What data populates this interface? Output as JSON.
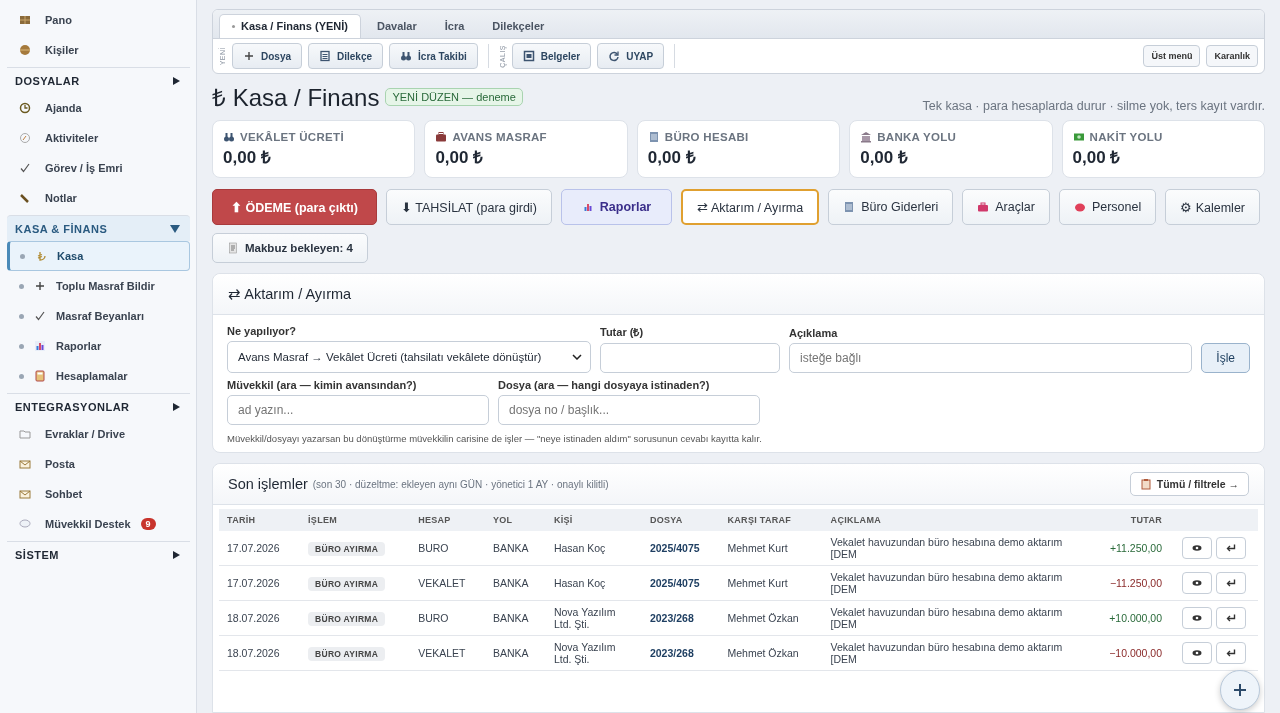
{
  "sidebar": {
    "entries": [
      {
        "kind": "item",
        "label": "Pano",
        "selected": false
      },
      {
        "kind": "item",
        "label": "Kişiler",
        "selected": false
      },
      {
        "kind": "section",
        "label": "DOSYALAR",
        "expanded": false
      },
      {
        "kind": "item",
        "label": "Ajanda",
        "selected": false
      },
      {
        "kind": "item",
        "label": "Aktiviteler",
        "selected": false
      },
      {
        "kind": "item",
        "label": "Görev / İş Emri",
        "selected": false
      },
      {
        "kind": "item",
        "label": "Notlar",
        "selected": false
      },
      {
        "kind": "section",
        "label": "KASA & FİNANS",
        "expanded": true
      },
      {
        "kind": "subitem",
        "label": "Kasa",
        "selected": true
      },
      {
        "kind": "subitem",
        "label": "Toplu Masraf Bildir",
        "selected": false
      },
      {
        "kind": "subitem",
        "label": "Masraf Beyanları",
        "selected": false
      },
      {
        "kind": "subitem",
        "label": "Raporlar",
        "selected": false
      },
      {
        "kind": "subitem",
        "label": "Hesaplamalar",
        "selected": false
      },
      {
        "kind": "section",
        "label": "ENTEGRASYONLAR",
        "expanded": false
      },
      {
        "kind": "item",
        "label": "Evraklar / Drive",
        "selected": false
      },
      {
        "kind": "item",
        "label": "Posta",
        "selected": false
      },
      {
        "kind": "item",
        "label": "Sohbet",
        "selected": false
      },
      {
        "kind": "item",
        "label": "Müvekkil Destek",
        "selected": false,
        "badge": "9"
      },
      {
        "kind": "section",
        "label": "SİSTEM",
        "expanded": false
      }
    ]
  },
  "tabs": [
    {
      "label": "Kasa / Finans (YENİ)",
      "selected": true
    },
    {
      "label": "Davalar",
      "selected": false
    },
    {
      "label": "İcra",
      "selected": false
    },
    {
      "label": "Dilekçeler",
      "selected": false
    }
  ],
  "toolbar": {
    "groups": [
      {
        "label": "YENİ",
        "buttons": [
          "Dosya",
          "Dilekçe",
          "İcra Takibi"
        ]
      },
      {
        "label": "ÇALIŞ",
        "buttons": [
          "Belgeler",
          "UYAP"
        ]
      }
    ],
    "right_buttons": [
      "Üst menü",
      "Karanlık"
    ]
  },
  "page": {
    "title": "₺ Kasa / Finans",
    "badge": "YENİ DÜZEN — deneme",
    "subtitle": "Tek kasa · para hesaplarda durur · silme yok, ters kayıt vardır."
  },
  "stats": [
    {
      "label": "VEKÂLET ÜCRETİ",
      "value": "0,00 ₺"
    },
    {
      "label": "AVANS MASRAF",
      "value": "0,00 ₺"
    },
    {
      "label": "BÜRO HESABI",
      "value": "0,00 ₺"
    },
    {
      "label": "BANKA YOLU",
      "value": "0,00 ₺"
    },
    {
      "label": "NAKİT YOLU",
      "value": "0,00 ₺"
    }
  ],
  "actions": [
    {
      "kind": "danger",
      "label": "⬆ ÖDEME (para çıktı)"
    },
    {
      "kind": "plain",
      "label": "⬇ TAHSİLAT (para girdi)"
    },
    {
      "kind": "primary",
      "label": "Raporlar"
    },
    {
      "kind": "active",
      "label": "⇄ Aktarım / Ayırma"
    },
    {
      "kind": "plain",
      "label": "Büro Giderleri"
    },
    {
      "kind": "plain",
      "label": "Araçlar"
    },
    {
      "kind": "plain",
      "label": "Personel"
    },
    {
      "kind": "plain",
      "label": "⚙ Kalemler"
    },
    {
      "kind": "plain",
      "label": "Makbuz bekleyen: 4"
    }
  ],
  "transfer_form": {
    "title": "⇄ Aktarım / Ayırma",
    "operation": {
      "label": "Ne yapılıyor?",
      "value": "Avans Masraf → Vekâlet Ücreti (tahsilatı vekâlete dönüştür)"
    },
    "amount": {
      "label": "Tutar (₺)"
    },
    "description": {
      "label": "Açıklama",
      "placeholder": "isteğe bağlı"
    },
    "submit": "İşle",
    "client": {
      "label": "Müvekkil (ara — kimin avansından?)",
      "placeholder": "ad yazın..."
    },
    "file": {
      "label": "Dosya (ara — hangi dosyaya istinaden?)",
      "placeholder": "dosya no / başlık..."
    },
    "note": "Müvekkil/dosyayı yazarsan bu dönüştürme müvekkilin carisine de işler — \"neye istinaden aldım\" sorusunun cevabı kayıtta kalır."
  },
  "transactions": {
    "title": "Son işlemler",
    "subtitle": "(son 30 · düzeltme: ekleyen aynı GÜN · yönetici 1 AY · onaylı kilitli)",
    "filter_button": "Tümü / filtrele →",
    "columns": [
      "TARİH",
      "İŞLEM",
      "HESAP",
      "YOL",
      "KİŞİ",
      "DOSYA",
      "KARŞI TARAF",
      "AÇIKLAMA",
      "TUTAR"
    ],
    "rows": [
      {
        "date": "17.07.2026",
        "operation": "BÜRO AYIRMA",
        "account": "BURO",
        "route": "BANKA",
        "person": "Hasan Koç",
        "file": "2025/4075",
        "counterparty": "Mehmet Kurt",
        "description": "Vekalet havuzundan büro hesabına demo aktarım [DEM",
        "amount": "+11.250,00",
        "positive": true
      },
      {
        "date": "17.07.2026",
        "operation": "BÜRO AYIRMA",
        "account": "VEKALET",
        "route": "BANKA",
        "person": "Hasan Koç",
        "file": "2025/4075",
        "counterparty": "Mehmet Kurt",
        "description": "Vekalet havuzundan büro hesabına demo aktarım [DEM",
        "amount": "−11.250,00",
        "positive": false
      },
      {
        "date": "18.07.2026",
        "operation": "BÜRO AYIRMA",
        "account": "BURO",
        "route": "BANKA",
        "person": "Nova Yazılım Ltd. Şti.",
        "file": "2023/268",
        "counterparty": "Mehmet Özkan",
        "description": "Vekalet havuzundan büro hesabına demo aktarım [DEM",
        "amount": "+10.000,00",
        "positive": true
      },
      {
        "date": "18.07.2026",
        "operation": "BÜRO AYIRMA",
        "account": "VEKALET",
        "route": "BANKA",
        "person": "Nova Yazılım Ltd. Şti.",
        "file": "2023/268",
        "counterparty": "Mehmet Özkan",
        "description": "Vekalet havuzundan büro hesabına demo aktarım [DEM",
        "amount": "−10.000,00",
        "positive": false
      }
    ]
  }
}
